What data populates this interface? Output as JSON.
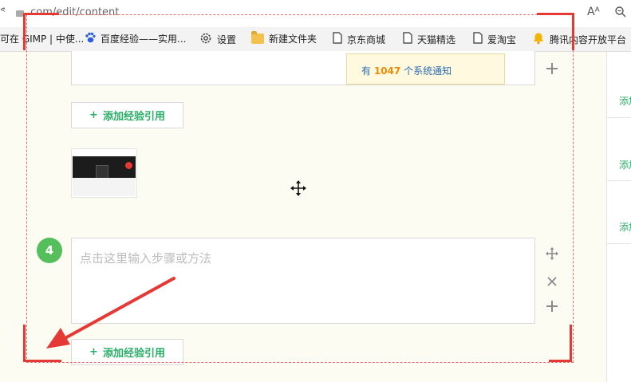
{
  "browser": {
    "address_prefix": "ᕝ",
    "url": ".com/edit/content",
    "icons": [
      "read-aloud-icon",
      "zoom-icon"
    ],
    "read_aloud_label": "Aᴬ",
    "bookmarks": [
      {
        "label": "可在 GIMP | 中使...",
        "icon": null
      },
      {
        "label": "百度经验——实用...",
        "icon": "paw-icon"
      },
      {
        "label": "设置",
        "icon": "gear-icon"
      },
      {
        "label": "新建文件夹",
        "icon": "folder-icon"
      },
      {
        "label": "京东商城",
        "icon": "doc-icon"
      },
      {
        "label": "天猫精选",
        "icon": "doc-icon"
      },
      {
        "label": "爱淘宝",
        "icon": "doc-icon"
      },
      {
        "label": "腾讯内容开放平台",
        "icon": "bell-icon"
      }
    ]
  },
  "notification": {
    "prefix": "有",
    "count": "1047",
    "suffix": "个系统通知"
  },
  "editor": {
    "add_reference_label": "添加经验引用",
    "add_reference_label_2": "添加经验引用",
    "step_number": "4",
    "step_placeholder": "点击这里输入步骤或方法"
  },
  "right_panel": {
    "items": [
      "添加",
      "添加",
      "添加"
    ]
  },
  "colors": {
    "accent_green": "#2aae67",
    "step_badge": "#54bf5b",
    "annotation_red": "#e53935",
    "notify_count": "#f08a00"
  }
}
